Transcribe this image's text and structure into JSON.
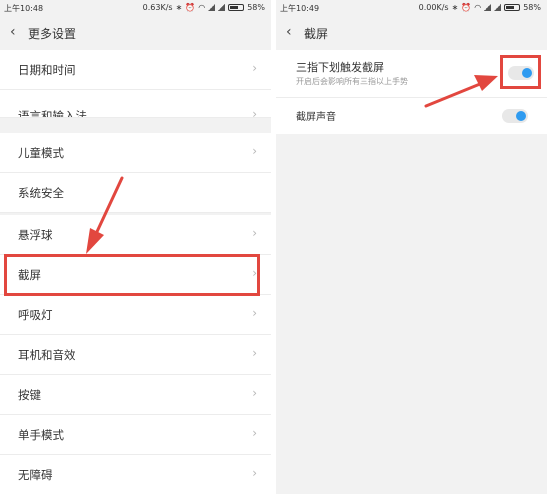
{
  "left": {
    "status": {
      "time": "上午10:48",
      "speed": "0.63K/s",
      "battery": "58%"
    },
    "header": {
      "back": "‹",
      "title": "更多设置"
    },
    "rows": [
      {
        "label": "日期和时间"
      },
      {
        "label": "语言和输入法"
      },
      {
        "label": "儿童模式"
      },
      {
        "label": "系统安全"
      },
      {
        "label": "悬浮球"
      },
      {
        "label": "截屏"
      },
      {
        "label": "呼吸灯"
      },
      {
        "label": "耳机和音效"
      },
      {
        "label": "按键"
      },
      {
        "label": "单手模式"
      },
      {
        "label": "无障碍"
      }
    ],
    "chevron": "›"
  },
  "right": {
    "status": {
      "time": "上午10:49",
      "speed": "0.00K/s",
      "battery": "58%"
    },
    "header": {
      "back": "‹",
      "title": "截屏"
    },
    "three_finger": {
      "title": "三指下划触发截屏",
      "subtitle": "开启后会影响所有三指以上手势",
      "enabled": true
    },
    "sound": {
      "title": "截屏声音",
      "enabled": true
    }
  },
  "colors": {
    "highlight": "#e2473f",
    "toggle_on": "#2f9bf0",
    "background": "#f2f2f2"
  }
}
